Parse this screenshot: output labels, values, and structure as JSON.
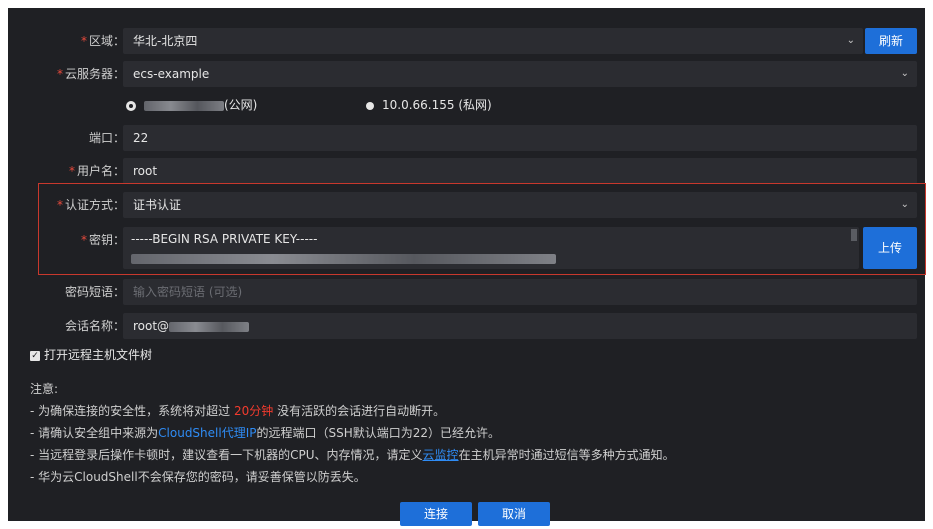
{
  "region": {
    "label": "区域：",
    "value": "华北-北京四",
    "refresh_label": "刷新"
  },
  "server": {
    "label": "云服务器：",
    "value": "ecs-example"
  },
  "ip": {
    "public_suffix": "(公网)",
    "private": "10.0.66.155 (私网)"
  },
  "port": {
    "label": "端口：",
    "value": "22"
  },
  "username": {
    "label": "用户名：",
    "value": "root"
  },
  "auth": {
    "label": "认证方式：",
    "value": "证书认证"
  },
  "key": {
    "label": "密钥：",
    "first_line": "-----BEGIN RSA PRIVATE KEY-----",
    "upload_label": "上传"
  },
  "passphrase": {
    "label": "密码短语：",
    "placeholder": "输入密码短语 (可选)"
  },
  "session": {
    "label": "会话名称：",
    "prefix": "root@"
  },
  "file_tree": {
    "check": "✓",
    "label": "打开远程主机文件树"
  },
  "notes": {
    "title": "注意:",
    "n1_a": "- 为确保连接的安全性，系统将对超过 ",
    "n1_red": "20分钟",
    "n1_b": " 没有活跃的会话进行自动断开。",
    "n2_a": "- 请确认安全组中来源为",
    "n2_link": "CloudShell代理IP",
    "n2_b": "的远程端口（SSH默认端口为22）已经允许。",
    "n3_a": "- 当远程登录后操作卡顿时，建议查看一下机器的CPU、内存情况，请定义",
    "n3_link": "云监控",
    "n3_b": "在主机异常时通过短信等多种方式通知。",
    "n4": "- 华为云CloudShell不会保存您的密码，请妥善保管以防丢失。"
  },
  "actions": {
    "connect": "连接",
    "cancel": "取消"
  },
  "colors": {
    "primary": "#1e6fd9",
    "required": "#e84a3c",
    "link": "#2f8cf5",
    "danger": "#f23b2e"
  }
}
